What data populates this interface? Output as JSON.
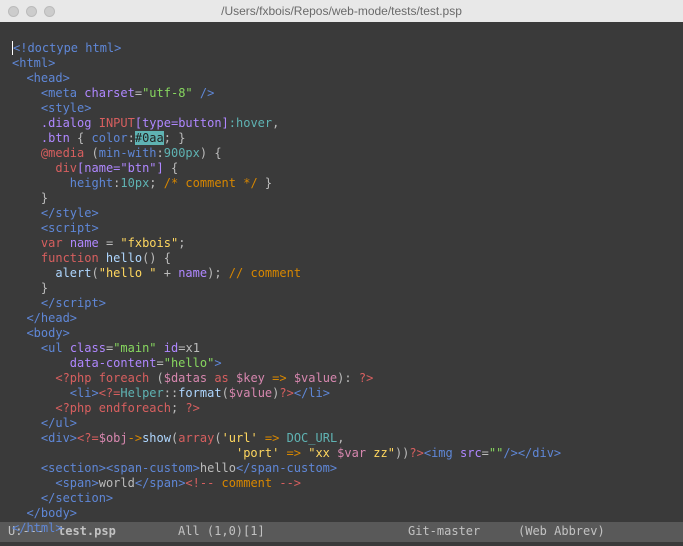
{
  "titlebar": {
    "path": "/Users/fxbois/Repos/web-mode/tests/test.psp"
  },
  "code": {
    "l0": {
      "doctype": "<!doctype html>"
    },
    "l1": {
      "html_open": "<html>"
    },
    "l2": {
      "head_open": "<head>"
    },
    "l3": {
      "meta_tag": "<meta",
      "attr": "charset",
      "eq": "=",
      "val": "\"utf-8\"",
      "close": " />"
    },
    "l4": {
      "style_open": "<style>"
    },
    "l5": {
      "sel1": ".dialog",
      "sel2": "INPUT",
      "sel3": "[type=button]",
      "pseudo": ":hover",
      "comma": ","
    },
    "l6": {
      "sel": ".btn",
      "brace": " { ",
      "prop": "color",
      "colon": ":",
      "val": "#0aa",
      "semi": ";",
      "brace2": " }"
    },
    "l7": {
      "at": "@media",
      "cond": " (",
      "prop": "min-with",
      "colon": ":",
      "val": "900px",
      "paren": ")",
      "brace": " {"
    },
    "l8": {
      "sel": "div",
      "attrsel": "[name=\"btn\"]",
      "brace": " {"
    },
    "l9": {
      "prop": "height",
      "colon": ":",
      "val": "10px",
      "semi": ";",
      "com": " /* comment */",
      "brace": " }"
    },
    "l10": {
      "brace": "}"
    },
    "l11": {
      "style_close": "</style>"
    },
    "l12": {
      "script_open": "<script>"
    },
    "l13": {
      "kw": "var",
      "name": " name",
      "eq": " = ",
      "str": "\"fxbois\"",
      "semi": ";"
    },
    "l14": {
      "kw": "function",
      "fn": " hello",
      "paren": "()",
      "brace": " {"
    },
    "l15": {
      "alert": "alert",
      "p1": "(",
      "str": "\"hello \"",
      "plus": " + ",
      "name": "name",
      "p2": ")",
      "semi": ";",
      "com": " // comment"
    },
    "l16": {
      "brace": "}"
    },
    "l17": {
      "script_close": "</script>"
    },
    "l18": {
      "head_close": "</head>"
    },
    "l19": {
      "body_open": "<body>"
    },
    "l20": {
      "ul_open": "<ul",
      "a1": " class",
      "eq1": "=",
      "v1": "\"main\"",
      "a2": " id",
      "eq2": "=",
      "v2": "x1"
    },
    "l21": {
      "attr": "data-content",
      "eq": "=",
      "val": "\"hello\"",
      "close": ">"
    },
    "l22": {
      "php_o": "<?php",
      "kw": " foreach",
      "p1": " (",
      "v1": "$datas",
      "as": " as ",
      "v2": "$key",
      "arr": " => ",
      "v3": "$value",
      "p2": ")",
      "c": ": ",
      "php_c": "?>"
    },
    "l23": {
      "li_o": "<li>",
      "php_o": "<?=",
      "cls": "Helper",
      "dd": "::",
      "fn": "format",
      "p1": "(",
      "v": "$value",
      "p2": ")",
      "php_c": "?>",
      "li_c": "</li>"
    },
    "l24": {
      "php_o": "<?php",
      "kw": " endforeach",
      "semi": ";",
      "php_c": " ?>"
    },
    "l25": {
      "ul_close": "</ul>"
    },
    "l26": {
      "div_o": "<div>",
      "php_o": "<?=",
      "v": "$obj",
      "arrow": "->",
      "fn": "show",
      "p1": "(",
      "arr": "array",
      "p2": "(",
      "k1": "'url'",
      "ar1": " => ",
      "c1": "DOC_URL",
      "comma": ","
    },
    "l27": {
      "k2": "'port'",
      "ar2": " => ",
      "v2": "\"xx ",
      "var": "$var",
      "v2b": " zz\"",
      "p3": "))",
      "php_c": "?>",
      "img_o": "<img",
      "attr": " src",
      "eq": "=",
      "val": "\"\"",
      "slash": "/>",
      "div_c": "</div>"
    },
    "l28": {
      "sec_o": "<section>",
      "span_o": "<span-custom>",
      "txt": "hello",
      "span_c": "</span-custom>"
    },
    "l29": {
      "span_o": "<span>",
      "txt": "world",
      "span_c": "</span>",
      "com_o": "<!--",
      "com_t": " comment ",
      "com_c": "-->"
    },
    "l30": {
      "sec_c": "</section>"
    },
    "l31": {
      "body_close": "</body>"
    },
    "l32": {
      "html_close": "</html>"
    }
  },
  "modeline": {
    "left": "U:---",
    "file": "test.psp",
    "pos": "All (1,0)[1]",
    "vc": "Git-master",
    "mode": "(Web Abbrev)"
  }
}
